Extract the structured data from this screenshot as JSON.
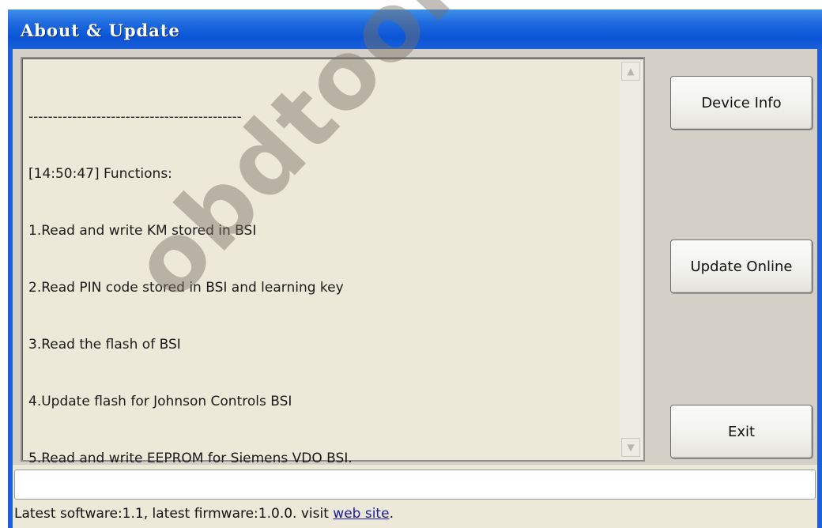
{
  "window": {
    "title": "About & Update"
  },
  "log": {
    "lines": [
      "--------------------------------------------",
      "[14:50:47] Functions:",
      "1.Read and write KM stored in BSI",
      "2.Read PIN code stored in BSI and learning key",
      "3.Read the flash of BSI",
      "4.Update flash for Johnson Controls BSI",
      "5.Read and write EEPROM for Siemens VDO BSI."
    ]
  },
  "buttons": {
    "device_info": "Device Info",
    "update_online": "Update Online",
    "exit": "Exit"
  },
  "status": {
    "prefix": "Latest software:1.1, latest firmware:1.0.0. visit ",
    "link": "web site",
    "suffix": "."
  },
  "watermark": "obdtoolshop.c",
  "icons": {
    "scroll_up": "scroll-up-arrow-icon",
    "scroll_down": "scroll-down-arrow-icon"
  }
}
